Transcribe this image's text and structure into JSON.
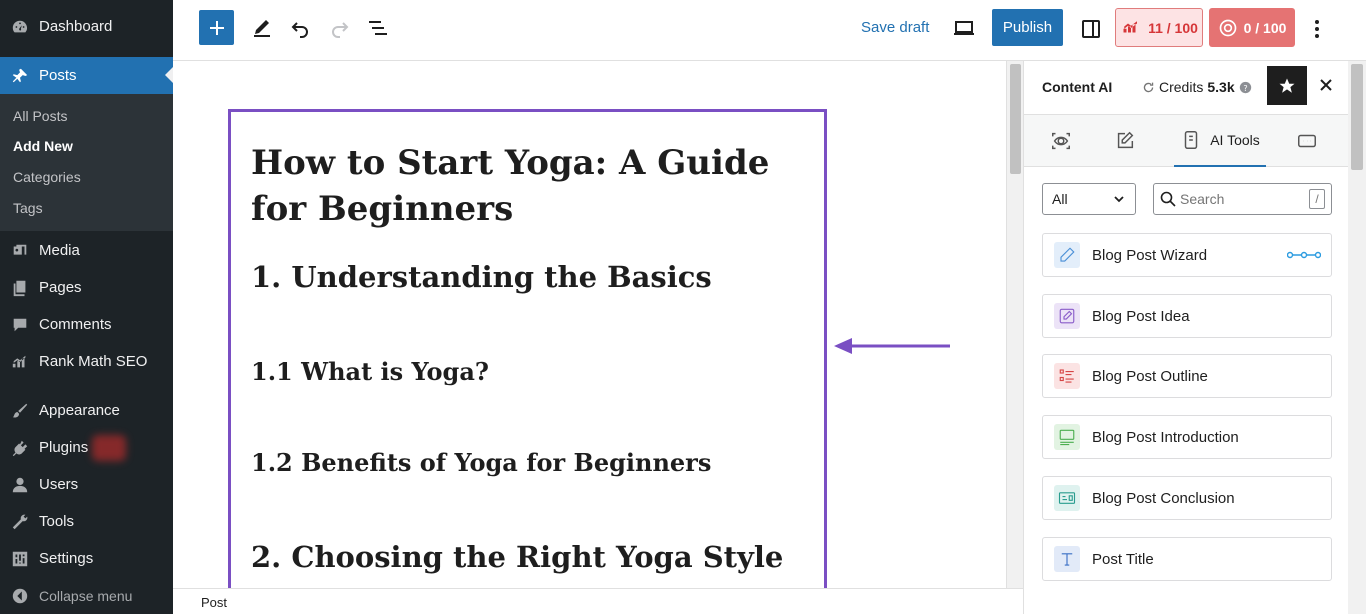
{
  "sidebar": {
    "items": [
      {
        "label": "Dashboard",
        "icon": "dashboard-icon"
      },
      {
        "label": "Posts",
        "icon": "pin-icon"
      },
      {
        "label": "Media",
        "icon": "media-icon"
      },
      {
        "label": "Pages",
        "icon": "pages-icon"
      },
      {
        "label": "Comments",
        "icon": "comments-icon"
      },
      {
        "label": "Rank Math SEO",
        "icon": "rank-math-icon"
      },
      {
        "label": "Appearance",
        "icon": "paintbrush-icon"
      },
      {
        "label": "Plugins",
        "icon": "plugin-icon"
      },
      {
        "label": "Users",
        "icon": "users-icon"
      },
      {
        "label": "Tools",
        "icon": "wrench-icon"
      },
      {
        "label": "Settings",
        "icon": "settings-icon"
      }
    ],
    "submenu": [
      "All Posts",
      "Add New",
      "Categories",
      "Tags"
    ],
    "collapse_label": "Collapse menu"
  },
  "toolbar": {
    "save_draft": "Save draft",
    "publish": "Publish",
    "seo_score": "11 / 100",
    "content_score": "0 / 100"
  },
  "content": {
    "title": "How to Start Yoga: A Guide for Beginners",
    "headings": [
      "1. Understanding the Basics",
      "1.1 What is Yoga?",
      "1.2 Benefits of Yoga for Beginners",
      "2. Choosing the Right Yoga Style"
    ]
  },
  "footer": {
    "breadcrumb": "Post"
  },
  "panel": {
    "title": "Content AI",
    "credits_label": "Credits",
    "credits_value": "5.3k",
    "active_tab": "AI Tools",
    "filter_value": "All",
    "search_placeholder": "Search",
    "search_shortcut": "/",
    "tools": [
      {
        "label": "Blog Post Wizard",
        "icon": "pencil-icon",
        "color": "#4a8fd6",
        "bg": "#e3eefa"
      },
      {
        "label": "Blog Post Idea",
        "icon": "edit-icon",
        "color": "#8a5cc9",
        "bg": "#ece3f7"
      },
      {
        "label": "Blog Post Outline",
        "icon": "list-icon",
        "color": "#d64545",
        "bg": "#fbe3e3"
      },
      {
        "label": "Blog Post Introduction",
        "icon": "intro-icon",
        "color": "#4caf50",
        "bg": "#e2f3e2"
      },
      {
        "label": "Blog Post Conclusion",
        "icon": "conclusion-icon",
        "color": "#2a9d8f",
        "bg": "#dff2ef"
      },
      {
        "label": "Post Title",
        "icon": "title-icon",
        "color": "#3a6fc4",
        "bg": "#e2eaf8"
      }
    ]
  },
  "colors": {
    "sidebar_bg": "#1d2327",
    "wp_blue": "#2271b1",
    "highlight": "#7a4fc3"
  }
}
